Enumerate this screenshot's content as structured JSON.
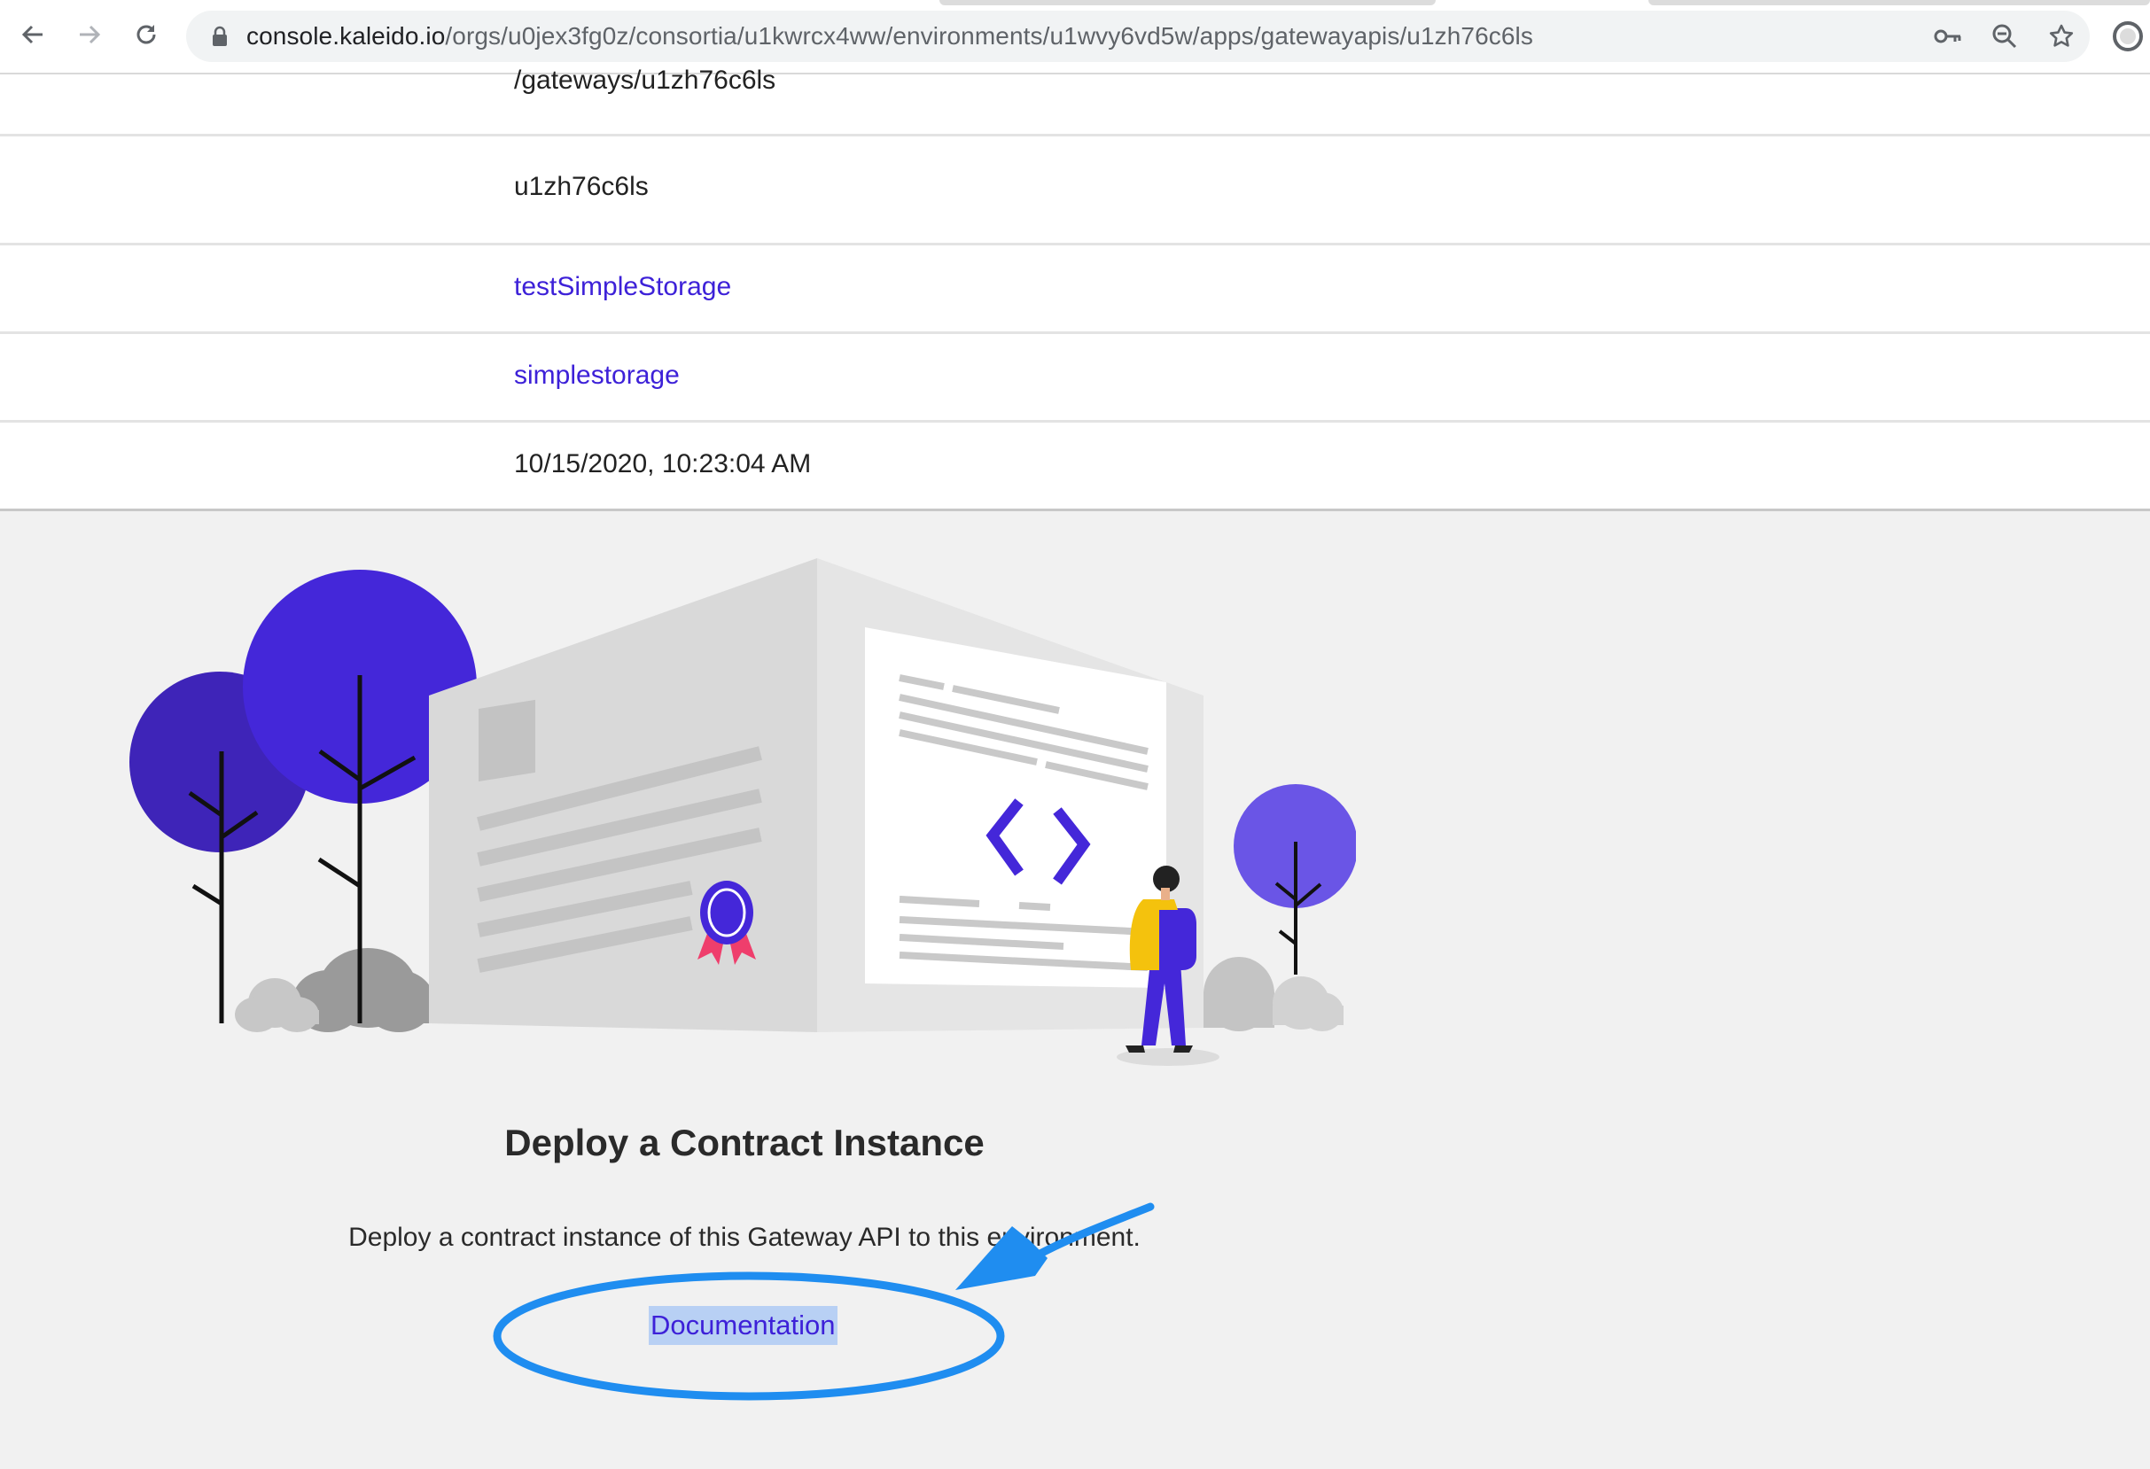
{
  "browser": {
    "url_host": "console.kaleido.io",
    "url_path": "/orgs/u0jex3fg0z/consortia/u1kwrcx4ww/environments/u1wvy6vd5w/apps/gatewayapis/u1zh76c6ls",
    "icons": [
      "back-arrow-icon",
      "forward-arrow-icon",
      "reload-icon",
      "lock-icon",
      "key-icon",
      "zoom-icon",
      "star-icon",
      "profile-icon"
    ]
  },
  "details": {
    "path_suffix": "/gateways/u1zh76c6ls",
    "gateway_id": "u1zh76c6ls",
    "gateway_api_name": "testSimpleStorage",
    "contract_name": "simplestorage",
    "created": "10/15/2020, 10:23:04 AM"
  },
  "empty_state": {
    "title": "Deploy a Contract Instance",
    "description": "Deploy a contract instance of this Gateway API to this environment.",
    "documentation_link": "Documentation"
  },
  "colors": {
    "accent": "#3d21d8",
    "annotation": "#1f8df0",
    "page_bg": "#f1f1f1"
  }
}
